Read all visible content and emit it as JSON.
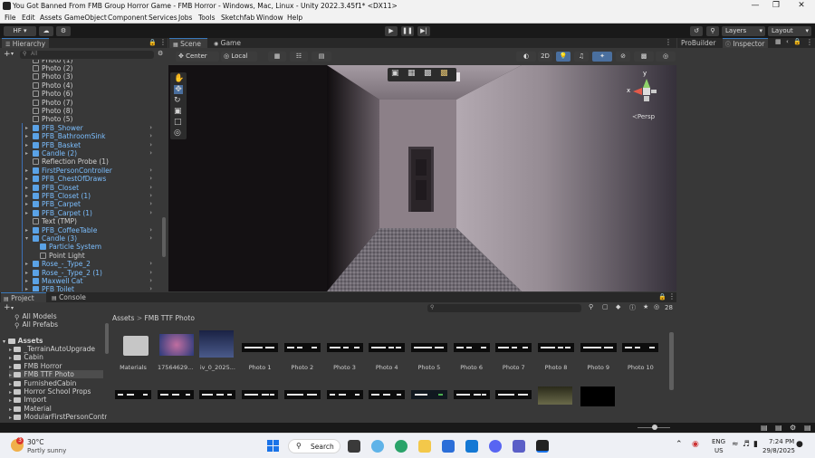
{
  "window": {
    "title": "You Got Banned From FMB Group Horror Game - FMB Horror - Windows, Mac, Linux - Unity 2022.3.45f1* <DX11>"
  },
  "menu": [
    "File",
    "Edit",
    "Assets",
    "GameObject",
    "Component",
    "Services",
    "Jobs",
    "Tools",
    "Sketchfab",
    "Window",
    "Help"
  ],
  "toolbar": {
    "account": "HF",
    "layers": "Layers",
    "layout": "Layout"
  },
  "hierarchy": {
    "tab": "Hierarchy",
    "search_placeholder": "All",
    "rows": [
      {
        "label": "Photo (2)",
        "type": "obj",
        "indent": 2
      },
      {
        "label": "Photo (3)",
        "type": "obj",
        "indent": 2
      },
      {
        "label": "Photo (4)",
        "type": "obj",
        "indent": 2
      },
      {
        "label": "Photo (6)",
        "type": "obj",
        "indent": 2
      },
      {
        "label": "Photo (7)",
        "type": "obj",
        "indent": 2
      },
      {
        "label": "Photo (8)",
        "type": "obj",
        "indent": 2
      },
      {
        "label": "Photo (5)",
        "type": "obj",
        "indent": 2
      },
      {
        "label": "PFB_Shower",
        "type": "pf",
        "indent": 2,
        "arrow": true
      },
      {
        "label": "PFB_BathroomSink",
        "type": "pf",
        "indent": 2,
        "arrow": true
      },
      {
        "label": "PFB_Basket",
        "type": "pf",
        "indent": 2,
        "arrow": true
      },
      {
        "label": "Candle (2)",
        "type": "pf",
        "indent": 2,
        "arrow": true
      },
      {
        "label": "Reflection Probe (1)",
        "type": "obj",
        "indent": 2
      },
      {
        "label": "FirstPersonController",
        "type": "pf",
        "indent": 2,
        "arrow": true
      },
      {
        "label": "PFB_ChestOfDraws",
        "type": "pf",
        "indent": 2,
        "arrow": true
      },
      {
        "label": "PFB_Closet",
        "type": "pf",
        "indent": 2,
        "arrow": true
      },
      {
        "label": "PFB_Closet (1)",
        "type": "pf",
        "indent": 2,
        "arrow": true
      },
      {
        "label": "PFB_Carpet",
        "type": "pf",
        "indent": 2,
        "arrow": true
      },
      {
        "label": "PFB_Carpet (1)",
        "type": "pf",
        "indent": 2,
        "arrow": true
      },
      {
        "label": "Text (TMP)",
        "type": "obj",
        "indent": 2
      },
      {
        "label": "PFB_CoffeeTable",
        "type": "pf",
        "indent": 2,
        "arrow": true
      },
      {
        "label": "Candle (3)",
        "type": "pf",
        "indent": 2,
        "arrow": true,
        "expanded": true
      },
      {
        "label": "Particle System",
        "type": "pf",
        "indent": 3
      },
      {
        "label": "Point Light",
        "type": "obj",
        "indent": 3
      },
      {
        "label": "Rose_-_Type_2",
        "type": "pf",
        "indent": 2,
        "arrow": true
      },
      {
        "label": "Rose_-_Type_2 (1)",
        "type": "pf",
        "indent": 2,
        "arrow": true
      },
      {
        "label": "Maxwell Cat",
        "type": "pf",
        "indent": 2,
        "arrow": true
      },
      {
        "label": "PFB Toilet",
        "type": "pf",
        "indent": 2,
        "arrow": true
      }
    ],
    "first_row_partial": "Photo (1)"
  },
  "scene": {
    "tabs": [
      "Scene",
      "Game"
    ],
    "pivot": "Center",
    "space": "Local",
    "mode_2d": "2D",
    "persp": "Persp",
    "gizmo_y": "y",
    "gizmo_x": "x"
  },
  "right_panel": {
    "tabs": [
      "ProBuilder",
      "Inspector"
    ]
  },
  "project": {
    "tabs": [
      "Project",
      "Console"
    ],
    "favorites": [
      "All Models",
      "All Prefabs"
    ],
    "assets_root": "Assets",
    "folders": [
      "_TerrainAutoUpgrade",
      "Cabin",
      "FMB Horror",
      "FMB TTF Photo",
      "FurnishedCabin",
      "Horror School Props",
      "Import",
      "Material",
      "ModularFirstPersonContr"
    ],
    "selected_folder": "FMB TTF Photo",
    "breadcrumb": [
      "Assets",
      "FMB TTF Photo"
    ],
    "visible_count": "28",
    "asset_labels": [
      "Materials",
      "17564629...",
      "iv_0_2025...",
      "Photo 1",
      "Photo 2",
      "Photo 3",
      "Photo 4",
      "Photo 5",
      "Photo 6",
      "Photo 7",
      "Photo 8",
      "Photo 9",
      "Photo 10"
    ]
  },
  "taskbar": {
    "weather_temp": "30°C",
    "weather_desc": "Partly sunny",
    "weather_badge": "3",
    "search": "Search",
    "lang": "ENG",
    "region": "US",
    "time": "7:24 PM",
    "date": "29/8/2025"
  },
  "colors": {
    "accent": "#3a79bb",
    "prefab_text": "#7cbfff",
    "editor_bg": "#383838"
  }
}
